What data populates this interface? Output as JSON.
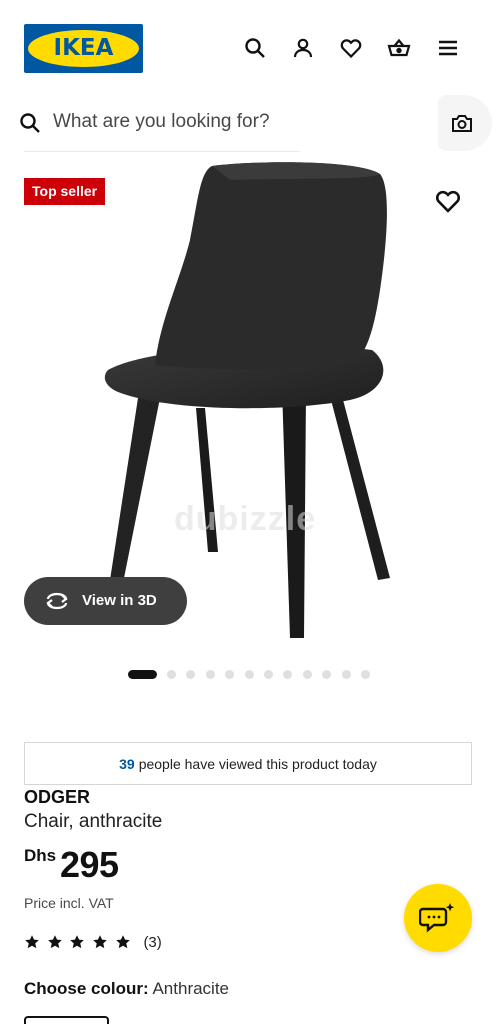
{
  "header": {
    "logo_text": "IKEA",
    "brand_colors": {
      "blue": "#0058a3",
      "yellow": "#ffdb00"
    },
    "icons": [
      "search-icon",
      "account-icon",
      "heart-icon",
      "basket-icon",
      "menu-icon"
    ]
  },
  "search": {
    "placeholder": "What are you looking for?",
    "camera_icon": "camera-icon"
  },
  "product": {
    "badge": "Top seller",
    "badge_color": "#cc0008",
    "watermark": "dubizzle",
    "view_3d_label": "View in 3D",
    "carousel": {
      "total_images": 13,
      "active_index": 0
    },
    "viewers": {
      "count": "39",
      "text": "people have viewed this product today"
    },
    "name": "ODGER",
    "description": "Chair, anthracite",
    "price": {
      "currency": "Dhs",
      "amount": "295"
    },
    "vat_note": "Price incl. VAT",
    "rating": {
      "stars": 5,
      "count_label": "(3)"
    },
    "colour": {
      "label": "Choose colour:",
      "value": "Anthracite"
    }
  },
  "chat": {
    "icon": "chat-icon"
  }
}
